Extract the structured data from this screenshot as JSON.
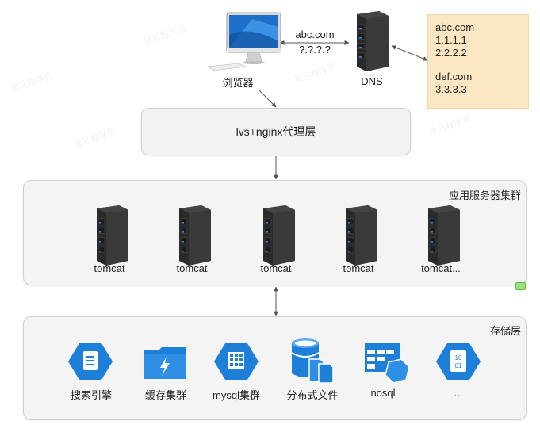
{
  "browser_label": "浏览器",
  "dns_label": "DNS",
  "link_labels": {
    "domain": "abc.com",
    "ip_placeholder": "?.?.?.?"
  },
  "dns_records": [
    "abc.com",
    "1.1.1.1",
    "2.2.2.2",
    "def.com",
    "3.3.3.3"
  ],
  "proxy_layer": "lvs+nginx代理层",
  "app_cluster": {
    "title": "应用服务器集群",
    "servers": [
      "tomcat",
      "tomcat",
      "tomcat",
      "tomcat",
      "tomcat..."
    ]
  },
  "storage_layer": {
    "title": "存储层",
    "items": [
      {
        "label": "搜索引擎",
        "icon": "search-engine-icon"
      },
      {
        "label": "缓存集群",
        "icon": "cache-cluster-icon"
      },
      {
        "label": "mysql集群",
        "icon": "mysql-cluster-icon"
      },
      {
        "label": "分布式文件",
        "icon": "distributed-file-icon"
      },
      {
        "label": "nosql",
        "icon": "nosql-icon"
      },
      {
        "label": "...",
        "icon": "binary-storage-icon"
      }
    ]
  },
  "colors": {
    "azure_blue": "#1e7fd8",
    "note_bg": "#fce7c4",
    "box_bg": "#f4f4f4"
  },
  "watermark_text": "黑马程序员"
}
